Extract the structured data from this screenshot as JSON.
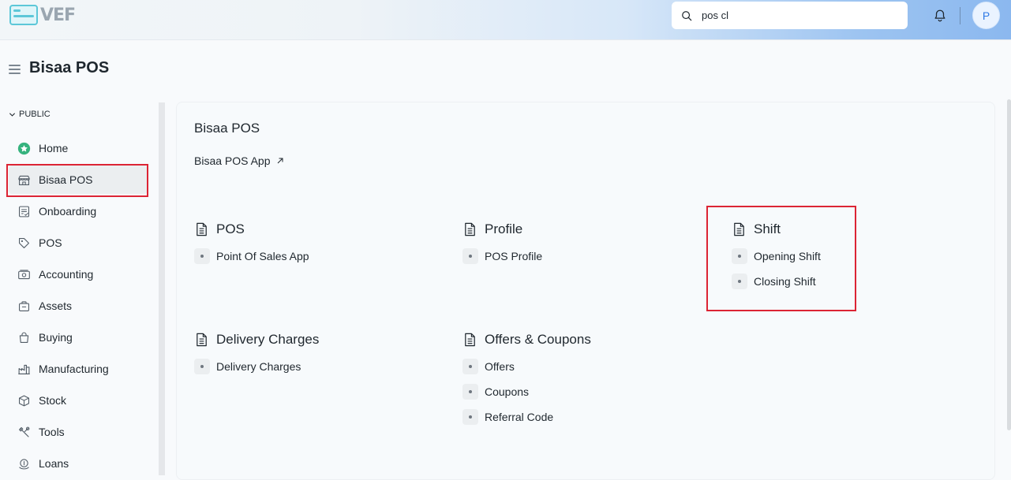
{
  "brand": {
    "logo_text": "VEF"
  },
  "search": {
    "value": "pos cl"
  },
  "user": {
    "avatar_letter": "P"
  },
  "page": {
    "title": "Bisaa POS"
  },
  "sidebar": {
    "group_label": "PUBLIC",
    "items": [
      {
        "label": "Home",
        "icon": "home-star-icon"
      },
      {
        "label": "Bisaa POS",
        "icon": "store-icon",
        "active": true
      },
      {
        "label": "Onboarding",
        "icon": "checklist-icon"
      },
      {
        "label": "POS",
        "icon": "tag-icon"
      },
      {
        "label": "Accounting",
        "icon": "accounting-icon"
      },
      {
        "label": "Assets",
        "icon": "assets-icon"
      },
      {
        "label": "Buying",
        "icon": "shopping-bag-icon"
      },
      {
        "label": "Manufacturing",
        "icon": "factory-icon"
      },
      {
        "label": "Stock",
        "icon": "box-icon"
      },
      {
        "label": "Tools",
        "icon": "tools-icon"
      },
      {
        "label": "Loans",
        "icon": "loans-icon"
      }
    ]
  },
  "workspace": {
    "title": "Bisaa POS",
    "shortcut": "Bisaa POS App",
    "sections": [
      {
        "title": "POS",
        "links": [
          "Point Of Sales App"
        ]
      },
      {
        "title": "Profile",
        "links": [
          "POS Profile"
        ]
      },
      {
        "title": "Shift",
        "links": [
          "Opening Shift",
          "Closing Shift"
        ]
      },
      {
        "title": "Delivery Charges",
        "links": [
          "Delivery Charges"
        ]
      },
      {
        "title": "Offers & Coupons",
        "links": [
          "Offers",
          "Coupons",
          "Referral Code"
        ]
      }
    ]
  },
  "colors": {
    "highlight": "#dc2434",
    "accent": "#2f7ae5"
  }
}
